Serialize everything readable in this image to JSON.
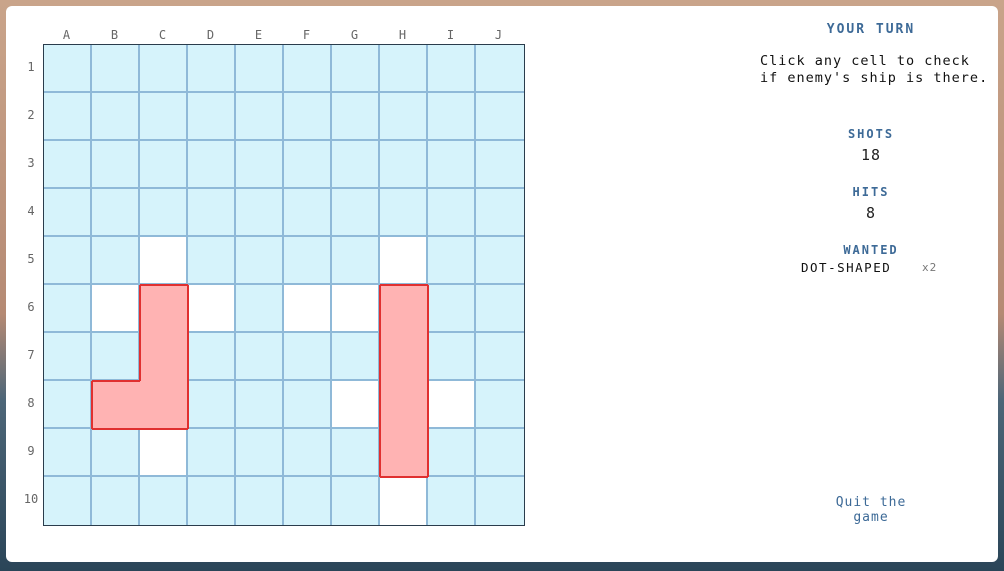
{
  "board": {
    "columns": [
      "A",
      "B",
      "C",
      "D",
      "E",
      "F",
      "G",
      "H",
      "I",
      "J"
    ],
    "rows": [
      "1",
      "2",
      "3",
      "4",
      "5",
      "6",
      "7",
      "8",
      "9",
      "10"
    ],
    "misses": [
      "C5",
      "H5",
      "B6",
      "D6",
      "F6",
      "G6",
      "G8",
      "I8",
      "C9",
      "H10"
    ],
    "hits": [
      "C6",
      "C7",
      "B8",
      "C8",
      "H6",
      "H7",
      "H8",
      "H9"
    ],
    "ships": [
      {
        "name": "L-shaped",
        "cells": [
          "C6",
          "C7",
          "C8",
          "B8"
        ]
      },
      {
        "name": "I-shaped",
        "cells": [
          "H6",
          "H7",
          "H8",
          "H9"
        ]
      }
    ],
    "colors": {
      "water": "#d6f3fb",
      "grid_line": "#8fb9d8",
      "miss": "#ffffff",
      "ship_fill": "#ffb3b3",
      "ship_border": "#e03030",
      "accent": "#3d6a97"
    }
  },
  "panel": {
    "turn_label": "YOUR TURN",
    "hint": "Click any cell to check if enemy's ship is there.",
    "shots_label": "SHOTS",
    "shots_value": "18",
    "hits_label": "HITS",
    "hits_value": "8",
    "wanted_label": "WANTED",
    "wanted_items": [
      {
        "name": "DOT-SHAPED",
        "count": "x2"
      }
    ],
    "quit_label": "Quit the game"
  }
}
